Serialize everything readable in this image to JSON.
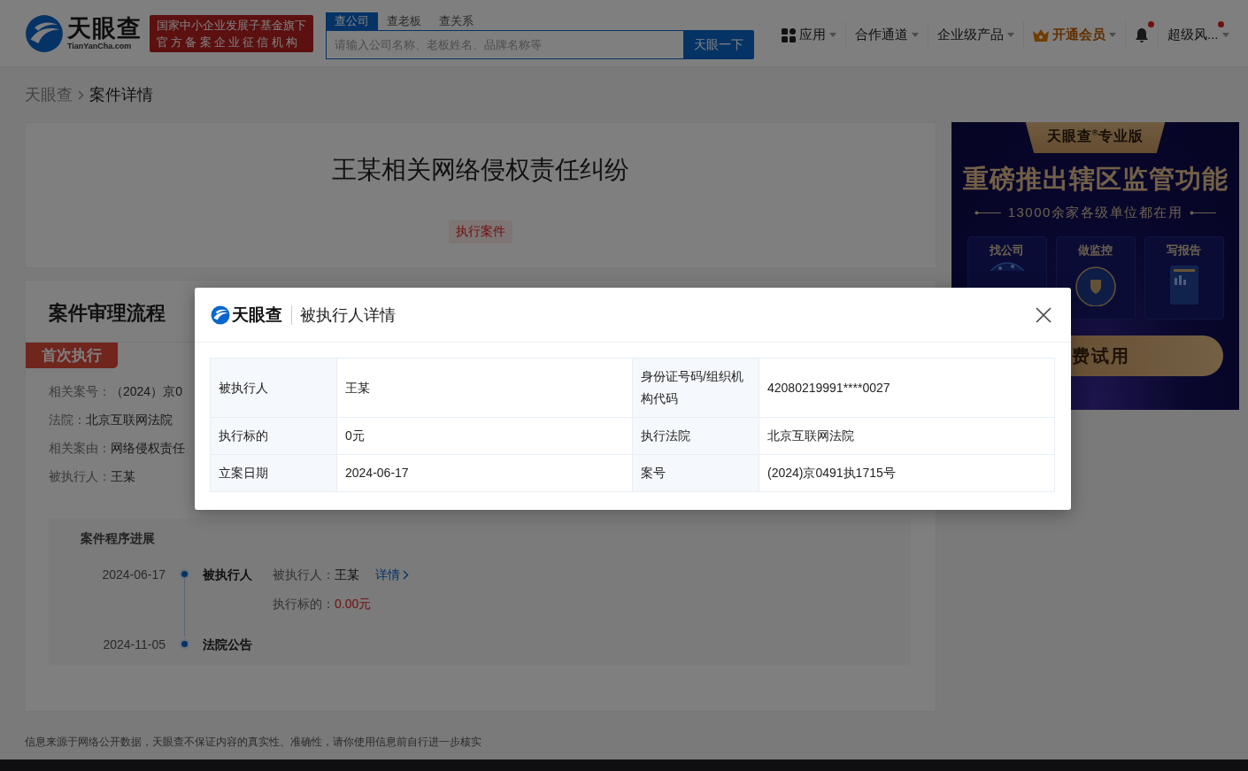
{
  "header": {
    "logo": {
      "name": "天眼查",
      "domain": "TianYanCha.com"
    },
    "banner": [
      "国家中小企业发展子基金旗下",
      "官方备案企业征信机构"
    ],
    "search": {
      "tabs": [
        {
          "label": "查公司",
          "selected": true
        },
        {
          "label": "查老板",
          "selected": false
        },
        {
          "label": "查关系",
          "selected": false
        }
      ],
      "placeholder": "请输入公司名称、老板姓名、品牌名称等",
      "button": "天眼一下"
    },
    "nav": [
      {
        "kind": "apps",
        "label": "应用"
      },
      {
        "kind": "menu",
        "label": "合作通道"
      },
      {
        "kind": "menu",
        "label": "企业级产品"
      },
      {
        "kind": "vip",
        "label": "开通会员"
      },
      {
        "kind": "bell",
        "dot": true
      },
      {
        "kind": "user",
        "label": "超级风...",
        "dot": true
      }
    ]
  },
  "breadcrumb": [
    "天眼查",
    "案件详情"
  ],
  "case": {
    "title": "王某相关网络侵权责任纠纷",
    "tag": "执行案件"
  },
  "process": {
    "heading": "案件审理流程",
    "stage": "首次执行",
    "fields": [
      {
        "label": "相关案号：",
        "value": "（2024）京0"
      },
      {
        "label": "法院：",
        "value": "北京互联网法院"
      },
      {
        "label": "相关案由：",
        "value": "网络侵权责任"
      },
      {
        "label": "被执行人：",
        "value": "王某"
      }
    ],
    "progress": {
      "title": "案件程序进展",
      "events": [
        {
          "date": "2024-06-17",
          "event": "被执行人",
          "details": [
            {
              "label": "被执行人：",
              "value": "王某",
              "kind": "plain",
              "link": "详情"
            },
            {
              "label": "执行标的：",
              "value": "0.00元",
              "kind": "amount"
            }
          ]
        },
        {
          "date": "2024-11-05",
          "event": "法院公告"
        }
      ]
    }
  },
  "disclaimer": "信息来源于网络公开数据，天眼查不保证内容的真实性、准确性，请你使用信息前自行进一步核实",
  "ad": {
    "badge": "天眼查$^{®}$专业版",
    "headline": "重磅推出辖区监管功能",
    "subline": "13000余家各级单位都在用",
    "tiles": [
      {
        "label": "找公司",
        "kind": "map"
      },
      {
        "label": "做监控",
        "kind": "radar"
      },
      {
        "label": "写报告",
        "kind": "report"
      }
    ],
    "button": "费试用"
  },
  "modal": {
    "logo": "天眼查",
    "title": "被执行人详情",
    "rows": [
      [
        {
          "label": "被执行人",
          "value": "王某"
        },
        {
          "label": "身份证号码/组织机构代码",
          "value": "42080219991****0027"
        }
      ],
      [
        {
          "label": "执行标的",
          "value": "0元"
        },
        {
          "label": "执行法院",
          "value": "北京互联网法院"
        }
      ],
      [
        {
          "label": "立案日期",
          "value": "2024-06-17"
        },
        {
          "label": "案号",
          "value": "(2024)京0491执1715号"
        }
      ]
    ]
  }
}
